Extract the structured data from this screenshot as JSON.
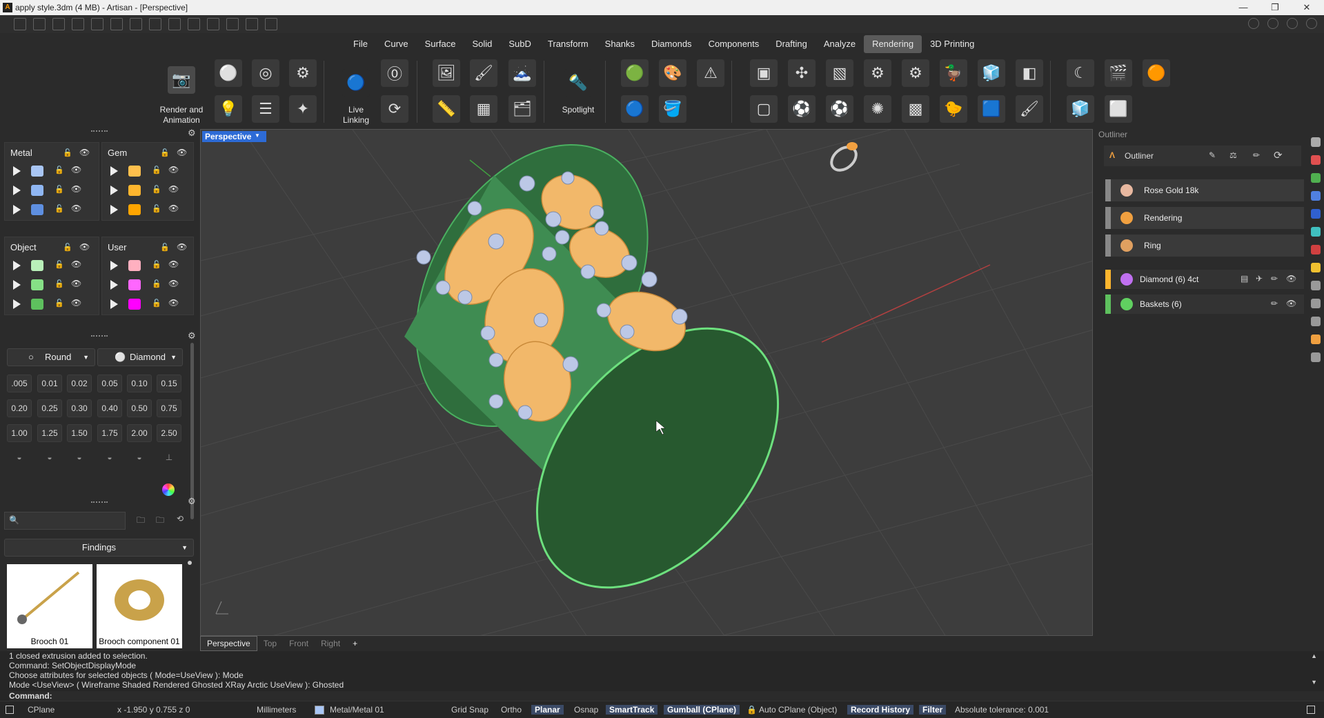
{
  "window": {
    "title": "apply style.3dm (4 MB) - Artisan - [Perspective]"
  },
  "menu": [
    "File",
    "Curve",
    "Surface",
    "Solid",
    "SubD",
    "Transform",
    "Shanks",
    "Diamonds",
    "Components",
    "Drafting",
    "Analyze",
    "Rendering",
    "3D Printing"
  ],
  "menu_active": "Rendering",
  "ribbon": {
    "render_label": "Render and Animation",
    "live_label": "Live Linking",
    "spotlight_label": "Spotlight"
  },
  "layers": {
    "metal": {
      "title": "Metal",
      "colors": [
        "#a9c6f5",
        "#8fb6f2",
        "#5e8fe0"
      ]
    },
    "gem": {
      "title": "Gem",
      "colors": [
        "#ffc04d",
        "#ffb62e",
        "#ffa500"
      ]
    },
    "object": {
      "title": "Object",
      "colors": [
        "#b9f0b9",
        "#86e086",
        "#5ec05e"
      ]
    },
    "user": {
      "title": "User",
      "colors": [
        "#ffb0c0",
        "#ff66ff",
        "#ff00ff"
      ]
    }
  },
  "gems": {
    "shape": "Round",
    "material": "Diamond",
    "sizes": [
      ".005",
      "0.01",
      "0.02",
      "0.05",
      "0.10",
      "0.15",
      "0.20",
      "0.25",
      "0.30",
      "0.40",
      "0.50",
      "0.75",
      "1.00",
      "1.25",
      "1.50",
      "1.75",
      "2.00",
      "2.50"
    ]
  },
  "library": {
    "search_placeholder": "",
    "category": "Findings",
    "items": [
      {
        "name": "Brooch 01"
      },
      {
        "name": "Brooch component 01"
      }
    ]
  },
  "viewport": {
    "name": "Perspective",
    "tabs": [
      "Perspective",
      "Top",
      "Front",
      "Right"
    ],
    "add": "+"
  },
  "outliner": {
    "title": "Outliner",
    "header": "Outliner",
    "items": [
      {
        "label": "Rose Gold 18k",
        "bar": "#888888",
        "icon_color": "#e8b8a0"
      },
      {
        "label": "Rendering",
        "bar": "#888888",
        "icon_color": "#f0a040"
      },
      {
        "label": "Ring",
        "bar": "#888888",
        "icon_color": "#e0a060"
      },
      {
        "label": "Diamond (6) 4ct",
        "bar": "#ffb62e",
        "icon_color": "#c070f0"
      },
      {
        "label": "Baskets (6)",
        "bar": "#5ec05e",
        "icon_color": "#60d060"
      }
    ]
  },
  "command": {
    "lines": [
      "1 closed extrusion added to selection.",
      "Command: SetObjectDisplayMode",
      "Choose attributes for selected objects ( Mode=UseView ): Mode",
      "Mode <UseView> ( Wireframe  Shaded  Rendered  Ghosted  XRay  Arctic  UseView ): Ghosted"
    ],
    "prompt": "Command:"
  },
  "status": {
    "cplane": "CPlane",
    "coords": "x -1.950  y 0.755  z 0",
    "units": "Millimeters",
    "layer": "Metal/Metal 01",
    "layer_color": "#a9c6f5",
    "grid_snap": "Grid Snap",
    "ortho": "Ortho",
    "planar": "Planar",
    "osnap": "Osnap",
    "smarttrack": "SmartTrack",
    "gumball": "Gumball (CPlane)",
    "autocplane": "Auto CPlane (Object)",
    "record": "Record History",
    "filter": "Filter",
    "tolerance": "Absolute tolerance: 0.001"
  }
}
